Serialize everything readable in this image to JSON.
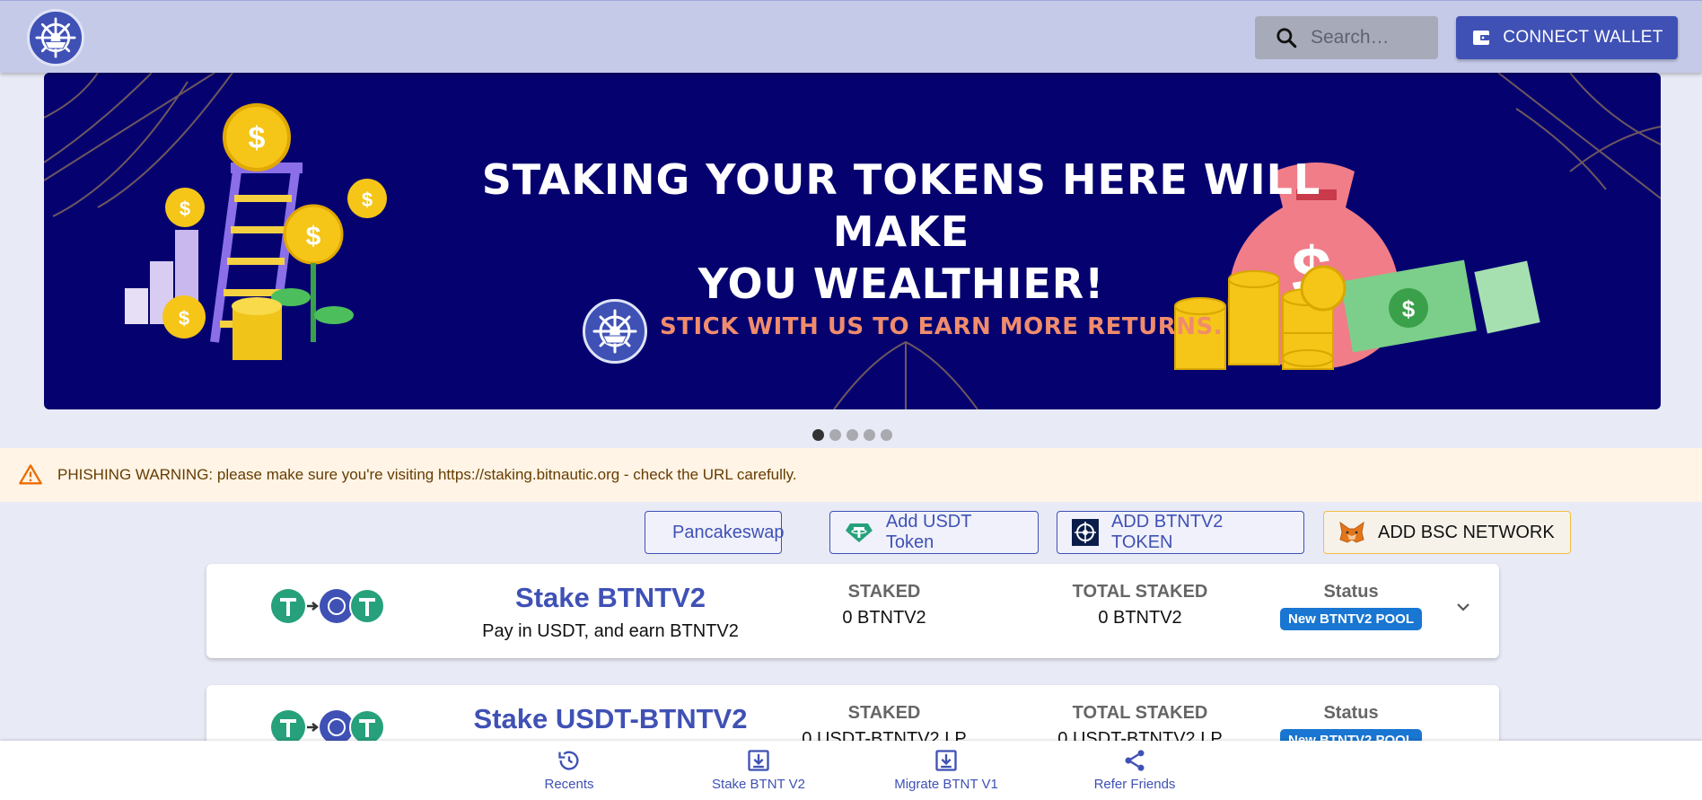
{
  "header": {
    "search": {
      "placeholder": "Search…",
      "icon": "search-icon"
    },
    "connect_wallet_label": "CONNECT WALLET"
  },
  "banner": {
    "title_line1": "STAKING YOUR TOKENS HERE WILL MAKE",
    "title_line2": "YOU WEALTHIER!",
    "subtitle": "STICK WITH US TO EARN MORE RETURNS.",
    "slide_count": 5,
    "active_slide": 1
  },
  "warning": {
    "text": "PHISHING WARNING: please make sure you're visiting https://staking.bitnautic.org - check the URL carefully."
  },
  "actions": {
    "pancakeswap": "Pancakeswap",
    "add_usdt": "Add USDT Token",
    "add_btntv2": "ADD BTNTV2 TOKEN",
    "add_bsc": "ADD BSC NETWORK"
  },
  "pools": [
    {
      "title": "Stake BTNTV2",
      "subtitle": "Pay in USDT, and earn BTNTV2",
      "staked_label": "STAKED",
      "staked_value": "0 BTNTV2",
      "total_label": "TOTAL STAKED",
      "total_value": "0 BTNTV2",
      "status_label": "Status",
      "status_badge": "New BTNTV2 POOL"
    },
    {
      "title": "Stake USDT-BTNTV2",
      "subtitle": "",
      "staked_label": "STAKED",
      "staked_value": "0 USDT-BTNTV2 LP",
      "total_label": "TOTAL STAKED",
      "total_value": "0 USDT-BTNTV2 LP",
      "status_label": "Status",
      "status_badge": "New BTNTV2 POOL"
    }
  ],
  "bottom_nav": [
    {
      "label": "Recents",
      "icon": "history-icon"
    },
    {
      "label": "Stake BTNT V2",
      "icon": "download-icon"
    },
    {
      "label": "Migrate BTNT V1",
      "icon": "download-icon"
    },
    {
      "label": "Refer Friends",
      "icon": "share-icon"
    }
  ],
  "colors": {
    "primary": "#3f51b5",
    "header_bg": "#c5cae9",
    "banner_bg": "#050270",
    "warning_bg": "#fff4e5",
    "badge": "#1976d2",
    "tether_green": "#26a17b"
  }
}
